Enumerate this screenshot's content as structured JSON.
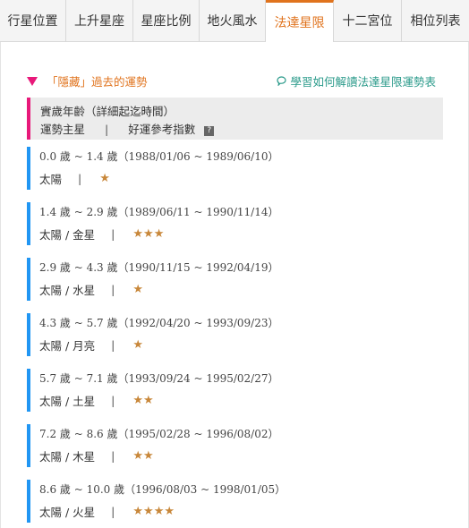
{
  "tabs": [
    {
      "label": "行星位置"
    },
    {
      "label": "上升星座"
    },
    {
      "label": "星座比例"
    },
    {
      "label": "地火風水"
    },
    {
      "label": "法達星限"
    },
    {
      "label": "十二宮位"
    },
    {
      "label": "相位列表"
    }
  ],
  "active_tab": "法達星限",
  "section": {
    "title": "「隱藏」過去的運勢",
    "help_link": "學習如何解讀法達星限運勢表"
  },
  "header": {
    "line1": "實歲年齡（詳細起迄時間）",
    "col_planet": "運勢主星",
    "separator": "|",
    "col_index": "好運參考指數",
    "help_icon": "?"
  },
  "periods": [
    {
      "age": "0.0 歲 ~ 1.4 歲（1988/01/06 ~ 1989/06/10）",
      "planets": "太陽",
      "stars": "★",
      "rating": 1
    },
    {
      "age": "1.4 歲 ~ 2.9 歲（1989/06/11 ~ 1990/11/14）",
      "planets": "太陽 / 金星",
      "stars": "★★★",
      "rating": 3
    },
    {
      "age": "2.9 歲 ~ 4.3 歲（1990/11/15 ~ 1992/04/19）",
      "planets": "太陽 / 水星",
      "stars": "★",
      "rating": 1
    },
    {
      "age": "4.3 歲 ~ 5.7 歲（1992/04/20 ~ 1993/09/23）",
      "planets": "太陽 / 月亮",
      "stars": "★",
      "rating": 1
    },
    {
      "age": "5.7 歲 ~ 7.1 歲（1993/09/24 ~ 1995/02/27）",
      "planets": "太陽 / 土星",
      "stars": "★★",
      "rating": 2
    },
    {
      "age": "7.2 歲 ~ 8.6 歲（1995/02/28 ~ 1996/08/02）",
      "planets": "太陽 / 木星",
      "stars": "★★",
      "rating": 2
    },
    {
      "age": "8.6 歲 ~ 10.0 歲（1996/08/03 ~ 1998/01/05）",
      "planets": "太陽 / 火星",
      "stars": "★★★★",
      "rating": 4
    }
  ],
  "colors": {
    "accent": "#e0731d",
    "pink": "#e8197a",
    "blue": "#2196f3",
    "star": "#c8873a",
    "link": "#2a9a8a"
  }
}
